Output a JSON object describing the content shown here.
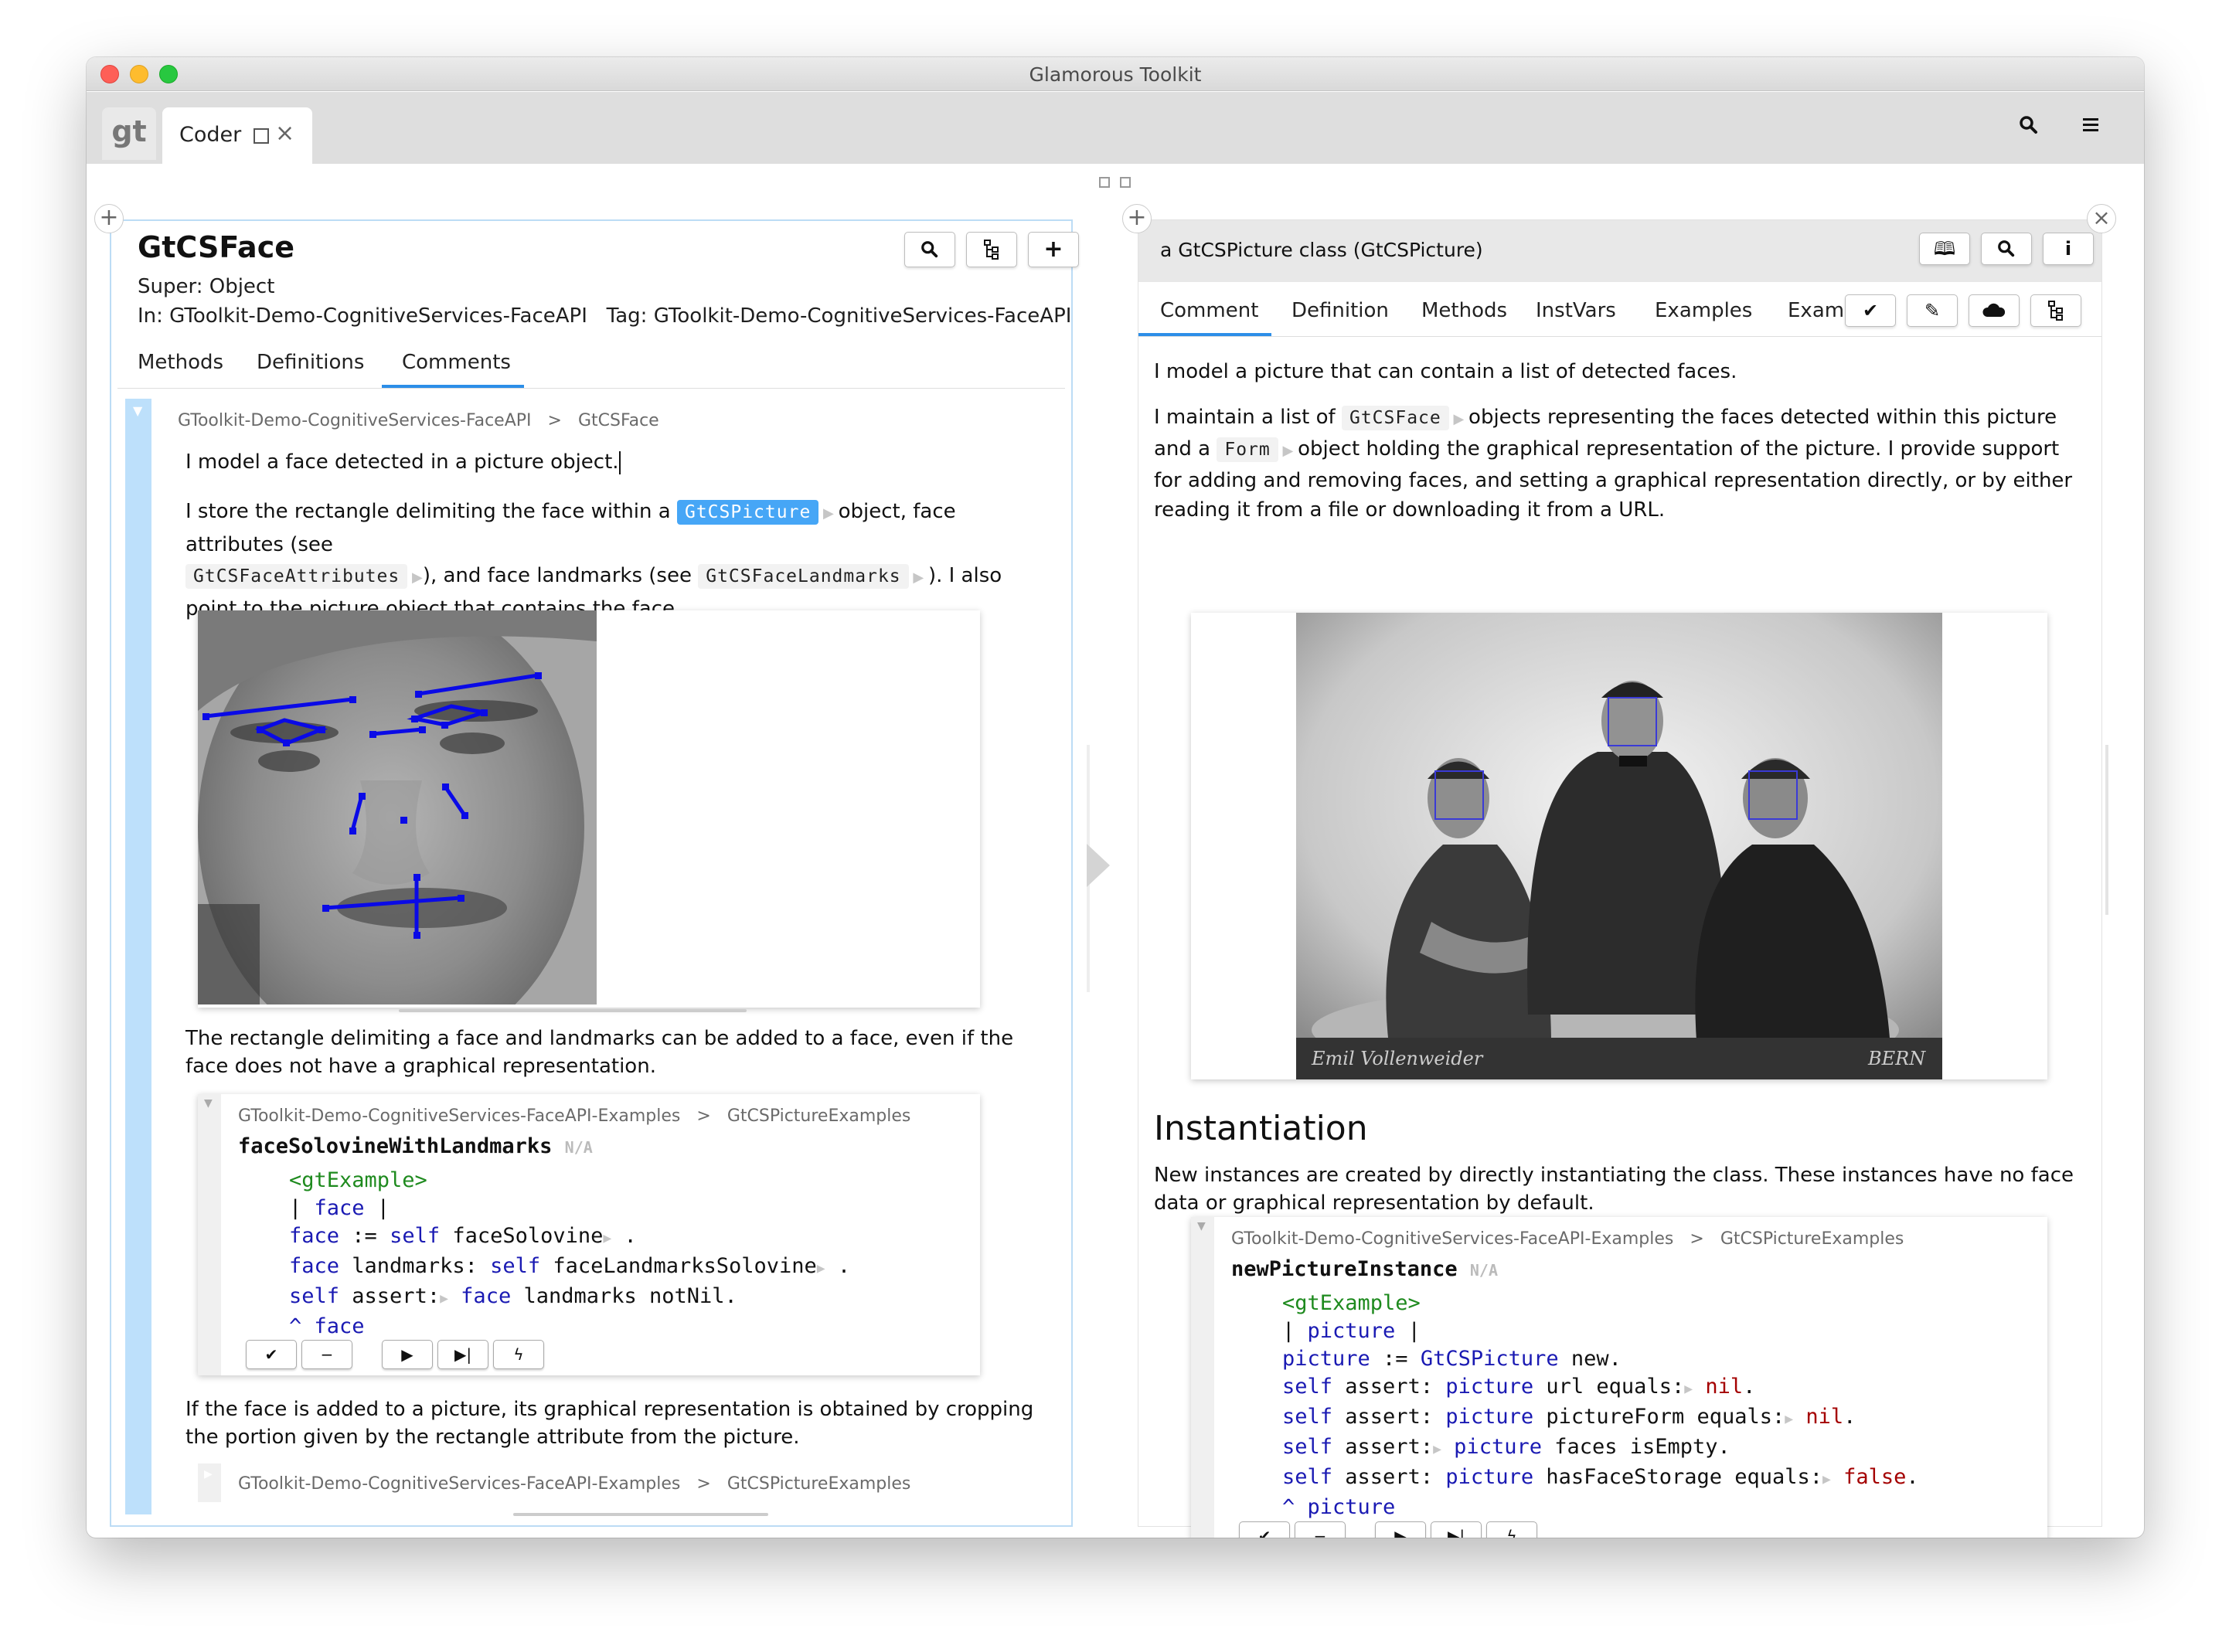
{
  "window": {
    "title": "Glamorous Toolkit"
  },
  "tabs": {
    "gt_logo": "gt",
    "coder_label": "Coder",
    "close_glyph": "×"
  },
  "left": {
    "class_name": "GtCSFace",
    "super": "Super: Object",
    "package_line": "In: GToolkit-Demo-CognitiveServices-FaceAPI   Tag: GToolkit-Demo-CognitiveServices-FaceAPI",
    "tabs": [
      "Methods",
      "Definitions",
      "Comments"
    ],
    "active_tab": "Comments",
    "breadcrumb": {
      "package": "GToolkit-Demo-CognitiveServices-FaceAPI",
      "sep": ">",
      "cls": "GtCSFace"
    },
    "p1": "I model a face detected in a picture object.",
    "p2_a": "I store the rectangle delimiting the face within a",
    "p2_chip1": "GtCSPicture",
    "p2_b": "object, face attributes (see",
    "p2_chip2": "GtCSFaceAttributes",
    "p2_c": "), and face landmarks (see",
    "p2_chip3": "GtCSFaceLandmarks",
    "p2_d": "). I also point to the picture object that contains the face.",
    "p3": "The rectangle delimiting a face and landmarks can be added to a face, even if the face does not have a graphical representation.",
    "example1": {
      "package": "GToolkit-Demo-CognitiveServices-FaceAPI-Examples",
      "sep": ">",
      "cls": "GtCSPictureExamples",
      "method": "faceSolovineWithLandmarks",
      "na": "N/A",
      "l1": "<gtExample>",
      "l2_a": "| ",
      "l2_b": "face",
      "l2_c": " |",
      "l3_a": "face",
      "l3_b": " := ",
      "l3_c": "self",
      "l3_d": " faceSolovine",
      "l3_e": " .",
      "l4_a": "face",
      "l4_b": " landmarks: ",
      "l4_c": "self",
      "l4_d": " faceLandmarksSolovine",
      "l4_e": " .",
      "l5_a": "self",
      "l5_b": " assert:",
      "l5_c": " face",
      "l5_d": " landmarks notNil.",
      "l6_a": "^ ",
      "l6_b": "face"
    },
    "p4": "If the face is added to a picture, its graphical representation is obtained by cropping the portion given by the rectangle attribute from the picture.",
    "example2": {
      "package": "GToolkit-Demo-CognitiveServices-FaceAPI-Examples",
      "sep": ">",
      "cls": "GtCSPictureExamples"
    }
  },
  "right": {
    "header": "a GtCSPicture class (GtCSPicture)",
    "tabs": [
      "Comment",
      "Definition",
      "Methods",
      "InstVars",
      "Examples",
      "Examp"
    ],
    "active_tab": "Comment",
    "p1": "I model a picture that can contain a list of detected faces.",
    "p2_a": "I maintain a list of",
    "p2_chip1": "GtCSFace",
    "p2_b": "objects representing the faces detected within this picture and a",
    "p2_chip2": "Form",
    "p2_c": "object holding the graphical representation of the picture. I provide support for adding and removing faces, and setting a graphical representation directly, or by either reading it from a file or downloading it from a URL.",
    "photo_caption_left": "Emil Vollenweider",
    "photo_caption_right": "BERN",
    "heading": "Instantiation",
    "p3": "New instances are created by directly instantiating the class. These instances have no face data or graphical representation by default.",
    "example": {
      "package": "GToolkit-Demo-CognitiveServices-FaceAPI-Examples",
      "sep": ">",
      "cls": "GtCSPictureExamples",
      "method": "newPictureInstance",
      "na": "N/A",
      "l1": "<gtExample>",
      "l2_a": "| ",
      "l2_b": "picture",
      "l2_c": " |",
      "l3_a": "picture",
      "l3_b": " := ",
      "l3_c": "GtCSPicture",
      "l3_d": " new.",
      "l4_a": "self",
      "l4_b": " assert: ",
      "l4_c": "picture",
      "l4_d": " url equals:",
      "l4_e": " nil",
      "l4_f": ".",
      "l5_a": "self",
      "l5_b": " assert: ",
      "l5_c": "picture",
      "l5_d": " pictureForm equals:",
      "l5_e": " nil",
      "l5_f": ".",
      "l6_a": "self",
      "l6_b": " assert:",
      "l6_c": " picture",
      "l6_d": " faces isEmpty.",
      "l7_a": "self",
      "l7_b": " assert: ",
      "l7_c": "picture",
      "l7_d": " hasFaceStorage equals:",
      "l7_e": " false",
      "l7_f": ".",
      "l8_a": "^ ",
      "l8_b": "picture"
    }
  },
  "colors": {
    "accent": "#2c8ee8",
    "selection": "#46a6f6",
    "keyword": "#1a1ab3",
    "pragma": "#1e8a1e",
    "literal": "#a40000",
    "landmark": "#0a0ae6"
  },
  "icons": [
    "search-icon",
    "hierarchy-icon",
    "plus-icon",
    "book-icon",
    "info-icon",
    "check-icon",
    "edit-icon",
    "cloud-icon",
    "close-icon",
    "menu-icon",
    "play-icon",
    "step-icon",
    "lightning-icon"
  ]
}
